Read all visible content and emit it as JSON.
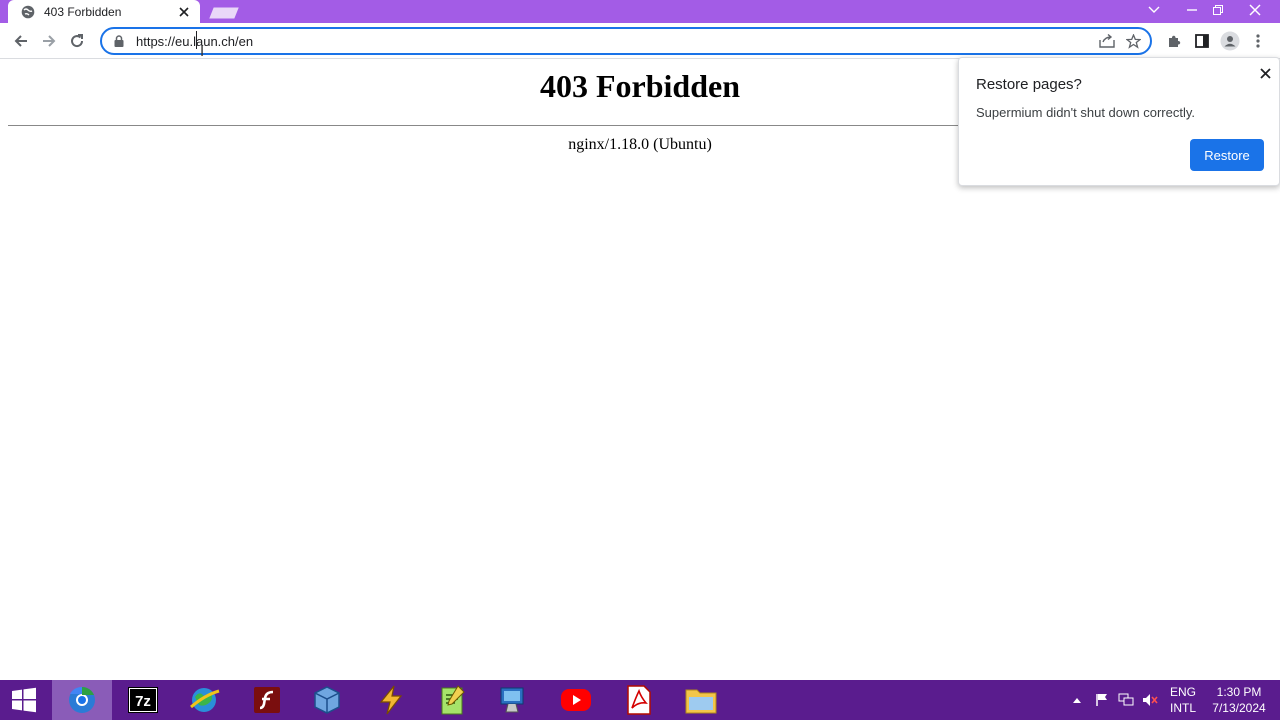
{
  "browser": {
    "tab": {
      "title": "403 Forbidden",
      "favicon": "globe-icon"
    },
    "window_controls": [
      "chevron-down-icon",
      "minimize-icon",
      "restore-icon",
      "close-icon"
    ],
    "address": {
      "url": "https://eu.laun.ch/en"
    },
    "toolbar_icons": [
      "back-arrow-icon",
      "forward-arrow-icon",
      "reload-icon",
      "lock-icon",
      "share-icon",
      "star-icon",
      "puzzle-icon",
      "side-panel-icon",
      "profile-icon",
      "more-vert-icon"
    ]
  },
  "page": {
    "heading": "403 Forbidden",
    "server": "nginx/1.18.0 (Ubuntu)"
  },
  "restore_bubble": {
    "title": "Restore pages?",
    "message": "Supermium didn't shut down correctly.",
    "button": "Restore"
  },
  "taskbar": {
    "apps": [
      "windows-start-icon",
      "browser-icon",
      "7zip-icon",
      "network-globe-icon",
      "flash-icon",
      "virtualbox-icon",
      "winamp-icon",
      "notepad-icon",
      "remote-desktop-icon",
      "youtube-icon",
      "pdf-icon",
      "file-explorer-icon"
    ],
    "tray": {
      "language_line1": "ENG",
      "language_line2": "INTL",
      "time": "1:30 PM",
      "date": "7/13/2024"
    }
  },
  "colors": {
    "titlebar": "#a35ce6",
    "taskbar": "#5a1c8e",
    "accent": "#1a73e8"
  }
}
